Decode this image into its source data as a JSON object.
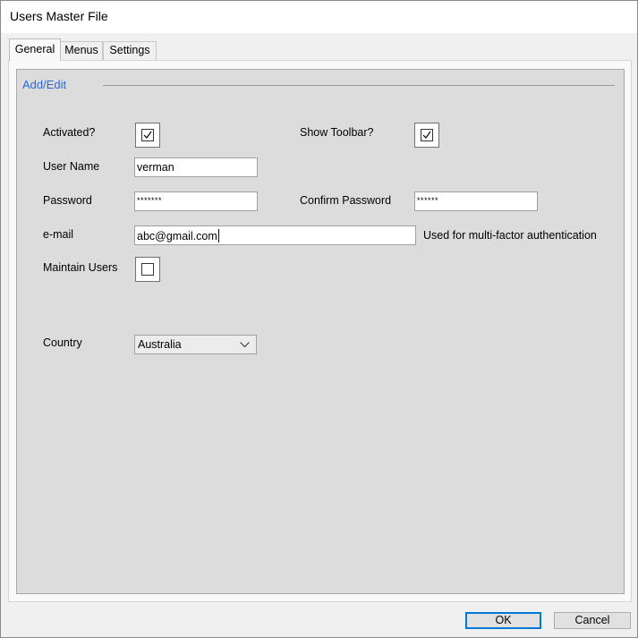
{
  "window": {
    "title": "Users Master File"
  },
  "tabs": [
    {
      "label": "General",
      "active": true
    },
    {
      "label": "Menus",
      "active": false
    },
    {
      "label": "Settings",
      "active": false
    }
  ],
  "group": {
    "title": "Add/Edit"
  },
  "form": {
    "activated": {
      "label": "Activated?",
      "checked": true
    },
    "show_toolbar": {
      "label": "Show Toolbar?",
      "checked": true
    },
    "user_name": {
      "label": "User Name",
      "value": "verman"
    },
    "password": {
      "label": "Password",
      "value": "*******"
    },
    "confirm_password": {
      "label": "Confirm Password",
      "value": "******"
    },
    "email": {
      "label": "e-mail",
      "value": "abc@gmail.com",
      "note": "Used for multi-factor authentication"
    },
    "maintain_users": {
      "label": "Maintain Users",
      "checked": false
    },
    "country": {
      "label": "Country",
      "value": "Australia"
    }
  },
  "buttons": {
    "ok": "OK",
    "cancel": "Cancel"
  },
  "icons": {
    "checkmark": "checkmark-icon",
    "dropdown": "chevron-down-icon"
  }
}
